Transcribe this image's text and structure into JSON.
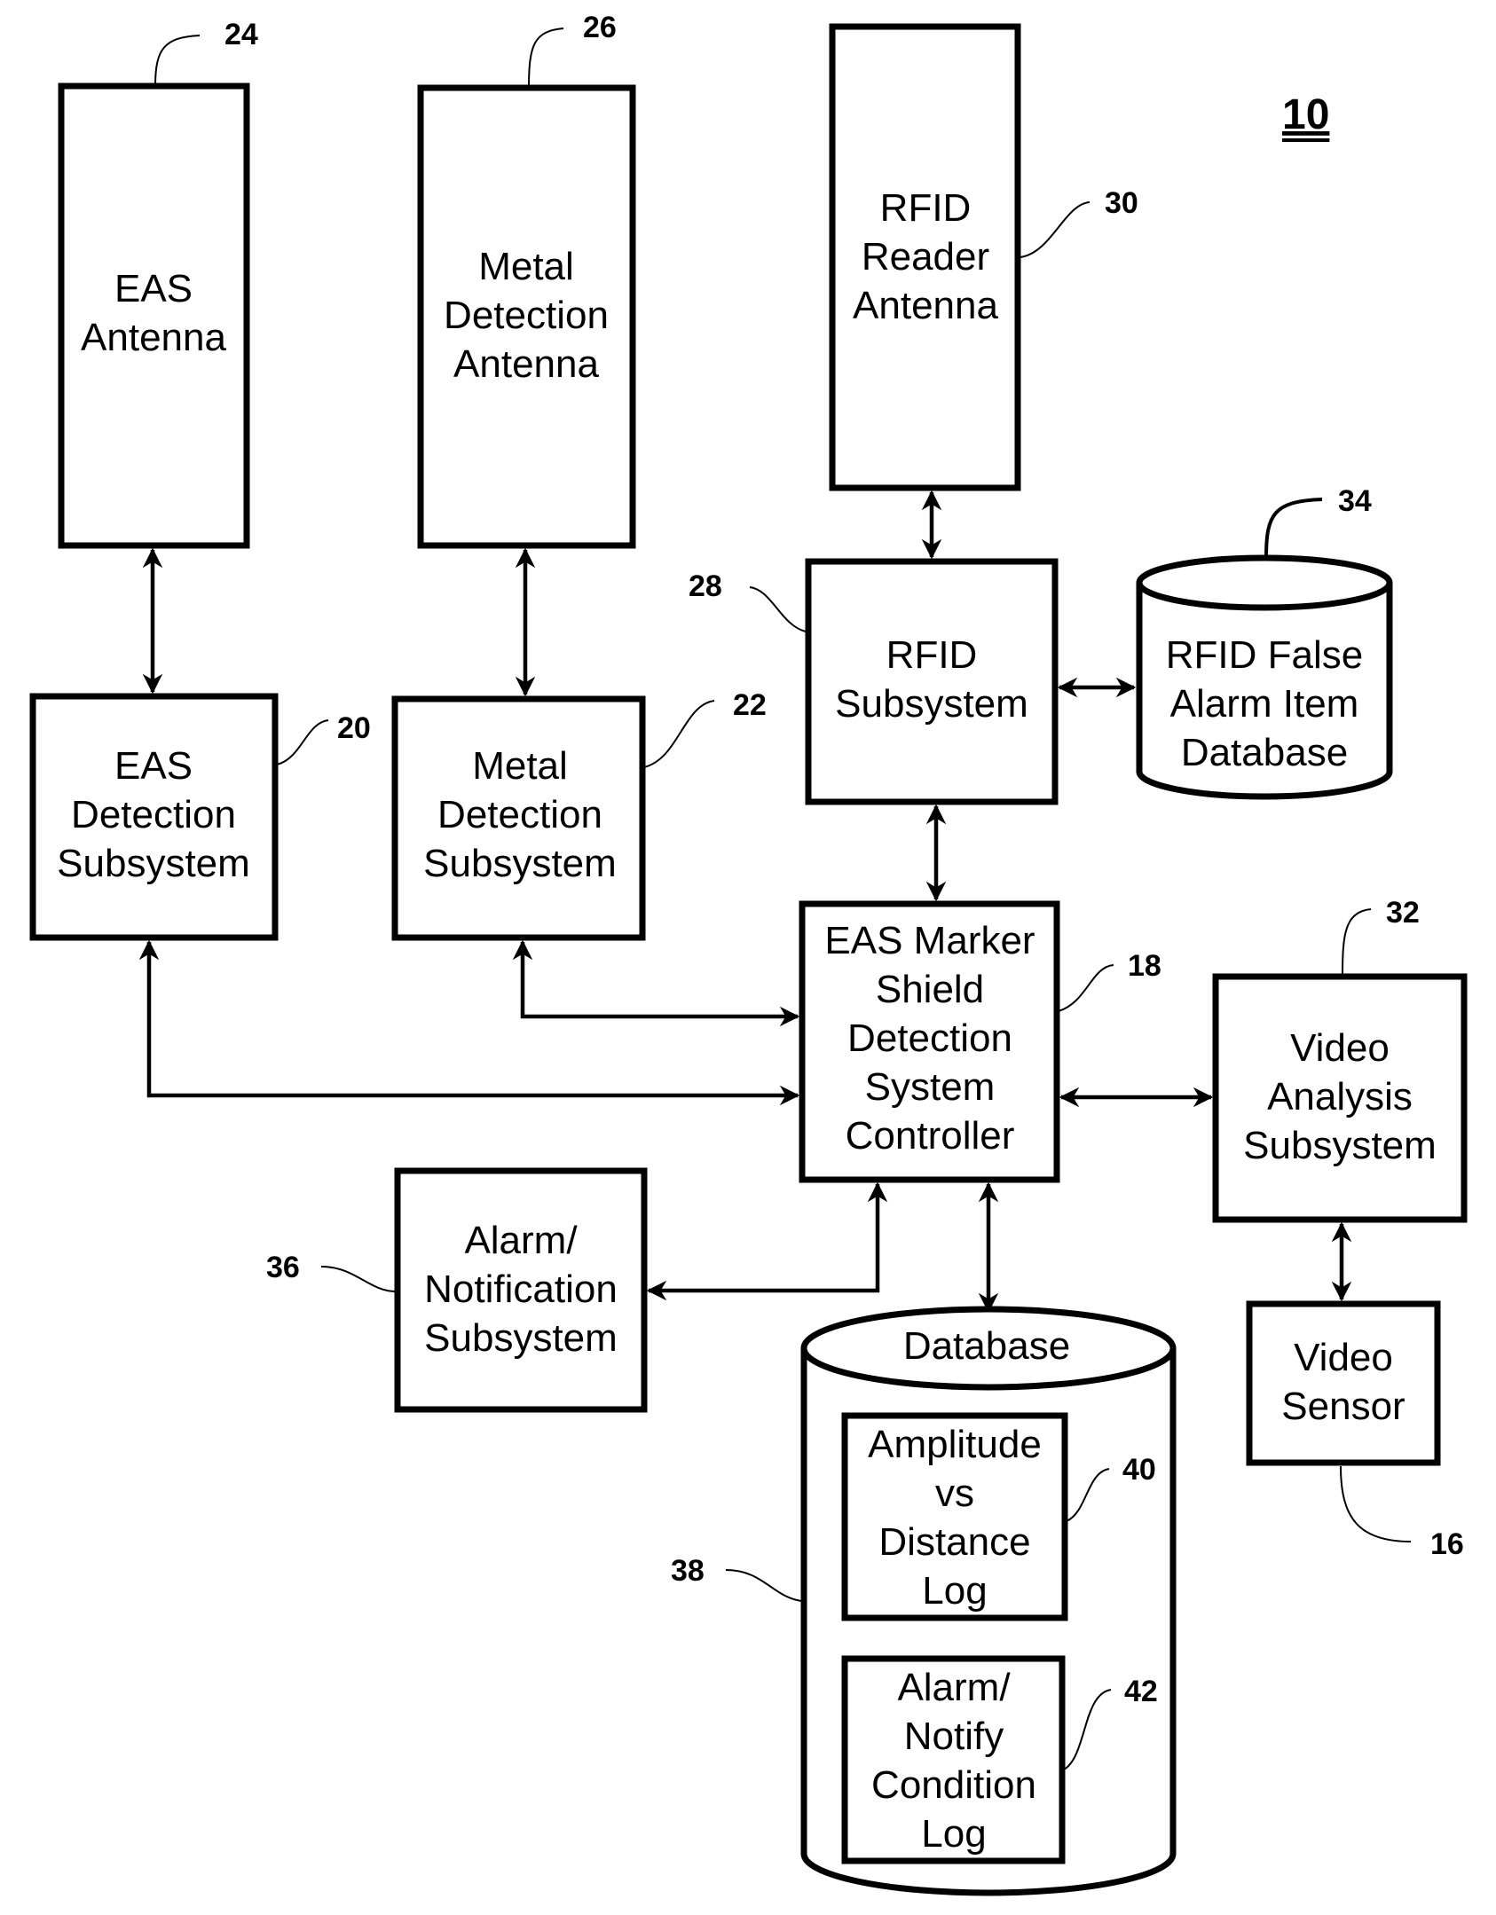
{
  "figure_number": "10",
  "blocks": {
    "eas_antenna": {
      "ref": "24",
      "lines": [
        "EAS",
        "Antenna"
      ]
    },
    "metal_antenna": {
      "ref": "26",
      "lines": [
        "Metal",
        "Detection",
        "Antenna"
      ]
    },
    "rfid_antenna": {
      "ref": "30",
      "lines": [
        "RFID",
        "Reader",
        "Antenna"
      ]
    },
    "rfid_subsystem": {
      "ref": "28",
      "lines": [
        "RFID",
        "Subsystem"
      ]
    },
    "rfid_database": {
      "ref": "34",
      "lines": [
        "RFID False",
        "Alarm Item",
        "Database"
      ]
    },
    "eas_detection": {
      "ref": "20",
      "lines": [
        "EAS",
        "Detection",
        "Subsystem"
      ]
    },
    "metal_detection": {
      "ref": "22",
      "lines": [
        "Metal",
        "Detection",
        "Subsystem"
      ]
    },
    "controller": {
      "ref": "18",
      "lines": [
        "EAS Marker",
        "Shield",
        "Detection",
        "System",
        "Controller"
      ]
    },
    "video_analysis": {
      "ref": "32",
      "lines": [
        "Video",
        "Analysis",
        "Subsystem"
      ]
    },
    "alarm_notification": {
      "ref": "36",
      "lines": [
        "Alarm/",
        "Notification",
        "Subsystem"
      ]
    },
    "database": {
      "ref": "38",
      "title": "Database"
    },
    "amplitude_log": {
      "ref": "40",
      "lines": [
        "Amplitude",
        "vs",
        "Distance",
        "Log"
      ]
    },
    "alarm_log": {
      "ref": "42",
      "lines": [
        "Alarm/",
        "Notify",
        "Condition",
        "Log"
      ]
    },
    "video_sensor": {
      "ref": "16",
      "lines": [
        "Video",
        "Sensor"
      ]
    }
  }
}
